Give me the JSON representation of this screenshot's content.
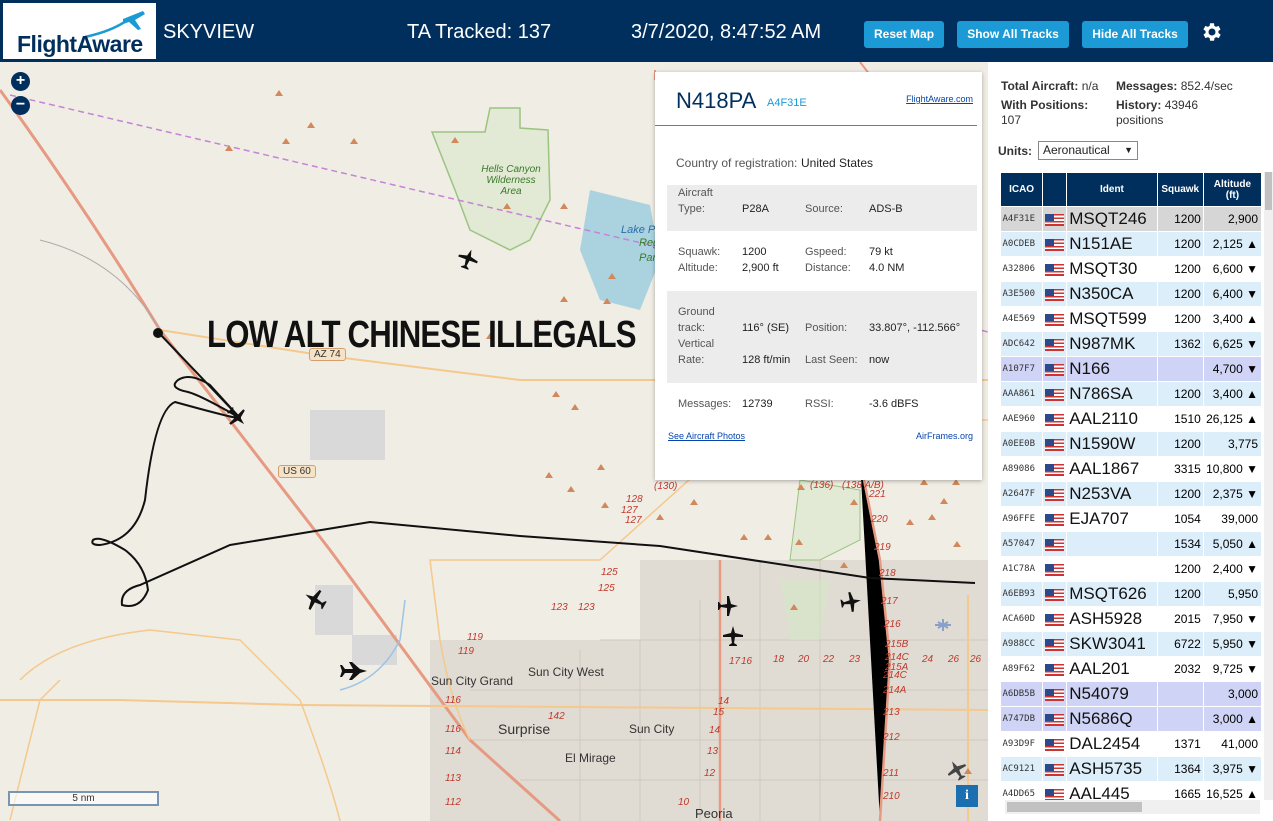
{
  "header": {
    "logo_text": "FlightAware",
    "app_name": "SKYVIEW",
    "tracked": "TA Tracked: 137",
    "datetime": "3/7/2020, 8:47:52 AM",
    "buttons": {
      "reset": "Reset Map",
      "show": "Show All Tracks",
      "hide": "Hide All Tracks"
    },
    "settings_icon": "gear-icon"
  },
  "map": {
    "zoom_in": "+",
    "zoom_out": "−",
    "overlay_text": "LOW ALT CHINESE ILLEGALS",
    "scale": "5 nm",
    "info": "i",
    "labels": {
      "hells_canyon": "Hells Canyon Wilderness Area",
      "lake_p": "Lake P",
      "reg": "Reg",
      "park": "Par",
      "sun_city_grand": "Sun City Grand",
      "sun_city_west": "Sun City West",
      "surprise": "Surprise",
      "sun_city": "Sun City",
      "el_mirage": "El Mirage",
      "peoria": "Peoria"
    },
    "shields": {
      "az74": "AZ 74",
      "us60": "US 60"
    },
    "routes": [
      "(130)",
      "128",
      "127",
      "127",
      "125",
      "125",
      "123",
      "123",
      "119",
      "119",
      "116",
      "116",
      "114",
      "113",
      "112",
      "142",
      "(136)",
      "(138 A/B)",
      "221",
      "220",
      "219",
      "218",
      "217",
      "216",
      "215B",
      "214C",
      "215A",
      "214C",
      "214A",
      "213",
      "212",
      "211",
      "210",
      "17",
      "16",
      "18",
      "20",
      "22",
      "23",
      "24",
      "26",
      "26",
      "14",
      "15",
      "14",
      "13",
      "12",
      "10"
    ]
  },
  "popup": {
    "callsign": "N418PA",
    "hex": "A4F31E",
    "link": "FlightAware.com",
    "country_label": "Country of registration:",
    "country": "United States",
    "aircraft_type_label": "Aircraft\nType:",
    "aircraft_type": "P28A",
    "source_label": "Source:",
    "source": "ADS-B",
    "squawk_label": "Squawk:",
    "squawk": "1200",
    "gspeed_label": "Gspeed:",
    "gspeed": "79 kt",
    "altitude_label": "Altitude:",
    "altitude": "2,900 ft",
    "distance_label": "Distance:",
    "distance": "4.0 NM",
    "ground_track_label": "Ground\ntrack:",
    "ground_track": "116° (SE)",
    "position_label": "Position:",
    "position": "33.807°, -112.566°",
    "vrate_label": "Vertical\nRate:",
    "vrate": "128 ft/min",
    "last_seen_label": "Last Seen:",
    "last_seen": "now",
    "messages_label": "Messages:",
    "messages": "12739",
    "rssi_label": "RSSI:",
    "rssi": "-3.6 dBFS",
    "photos_link": "See Aircraft Photos",
    "airframes_link": "AirFrames.org"
  },
  "panel": {
    "total_label": "Total Aircraft:",
    "total": "n/a",
    "messages_label": "Messages:",
    "messages": "852.4/sec",
    "with_pos_label": "With Positions:",
    "with_pos": "107",
    "history_label": "History:",
    "history": "43946 positions",
    "units_label": "Units:",
    "units": "Aeronautical",
    "columns": [
      "ICAO",
      "",
      "Ident",
      "Squawk",
      "Altitude (ft)"
    ],
    "rows": [
      {
        "icao": "A4F31E",
        "ident": "MSQT246",
        "squawk": "1200",
        "alt": "2,900",
        "style": "sel"
      },
      {
        "icao": "A0CDEB",
        "ident": "N151AE",
        "squawk": "1200",
        "alt": "2,125 ▲",
        "style": "a"
      },
      {
        "icao": "A32806",
        "ident": "MSQT30",
        "squawk": "1200",
        "alt": "6,600 ▼",
        "style": "b"
      },
      {
        "icao": "A3E500",
        "ident": "N350CA",
        "squawk": "1200",
        "alt": "6,400 ▼",
        "style": "a"
      },
      {
        "icao": "A4E569",
        "ident": "MSQT599",
        "squawk": "1200",
        "alt": "3,400 ▲",
        "style": "b"
      },
      {
        "icao": "ADC642",
        "ident": "N987MK",
        "squawk": "1362",
        "alt": "6,625 ▼",
        "style": "a"
      },
      {
        "icao": "A107F7",
        "ident": "N166",
        "squawk": "",
        "alt": "4,700 ▼",
        "style": "nopos"
      },
      {
        "icao": "AAA861",
        "ident": "N786SA",
        "squawk": "1200",
        "alt": "3,400 ▲",
        "style": "a"
      },
      {
        "icao": "AAE960",
        "ident": "AAL2110",
        "squawk": "1510",
        "alt": "26,125 ▲",
        "style": "b"
      },
      {
        "icao": "A0EE0B",
        "ident": "N1590W",
        "squawk": "1200",
        "alt": "3,775",
        "style": "a"
      },
      {
        "icao": "A89086",
        "ident": "AAL1867",
        "squawk": "3315",
        "alt": "10,800 ▼",
        "style": "b"
      },
      {
        "icao": "A2647F",
        "ident": "N253VA",
        "squawk": "1200",
        "alt": "2,375 ▼",
        "style": "a"
      },
      {
        "icao": "A96FFE",
        "ident": "EJA707",
        "squawk": "1054",
        "alt": "39,000",
        "style": "b"
      },
      {
        "icao": "A57047",
        "ident": "",
        "squawk": "1534",
        "alt": "5,050 ▲",
        "style": "a"
      },
      {
        "icao": "A1C78A",
        "ident": "",
        "squawk": "1200",
        "alt": "2,400 ▼",
        "style": "b"
      },
      {
        "icao": "A6EB93",
        "ident": "MSQT626",
        "squawk": "1200",
        "alt": "5,950",
        "style": "a"
      },
      {
        "icao": "ACA60D",
        "ident": "ASH5928",
        "squawk": "2015",
        "alt": "7,950 ▼",
        "style": "b"
      },
      {
        "icao": "A988CC",
        "ident": "SKW3041",
        "squawk": "6722",
        "alt": "5,950 ▼",
        "style": "a"
      },
      {
        "icao": "A89F62",
        "ident": "AAL201",
        "squawk": "2032",
        "alt": "9,725 ▼",
        "style": "b"
      },
      {
        "icao": "A6DB5B",
        "ident": "N54079",
        "squawk": "",
        "alt": "3,000",
        "style": "nopos"
      },
      {
        "icao": "A747DB",
        "ident": "N5686Q",
        "squawk": "",
        "alt": "3,000 ▲",
        "style": "nopos"
      },
      {
        "icao": "A93D9F",
        "ident": "DAL2454",
        "squawk": "1371",
        "alt": "41,000",
        "style": "b"
      },
      {
        "icao": "AC9121",
        "ident": "ASH5735",
        "squawk": "1364",
        "alt": "3,975 ▼",
        "style": "a"
      },
      {
        "icao": "A4DD65",
        "ident": "AAL445",
        "squawk": "1665",
        "alt": "16,525 ▲",
        "style": "b"
      }
    ]
  },
  "colors": {
    "header_bg": "#002f5d",
    "button": "#1b9ad6",
    "track": "#111111",
    "selected_row": "#d6d6d6",
    "no_position_row": "#cfd3f5"
  }
}
